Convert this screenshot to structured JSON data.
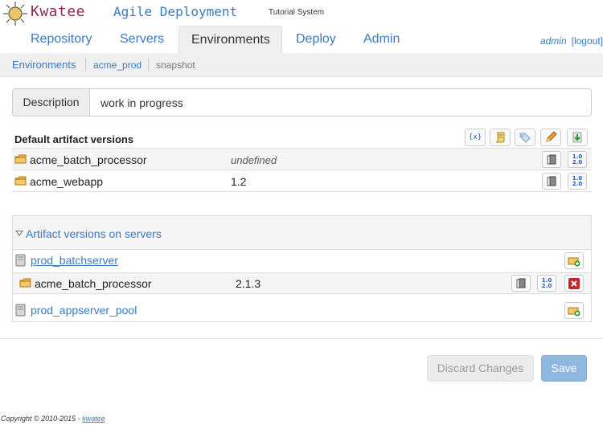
{
  "brand": {
    "name": "Kwatee",
    "subtitle": "Agile Deployment",
    "system": "Tutorial System"
  },
  "nav": {
    "tabs": [
      {
        "label": "Repository"
      },
      {
        "label": "Servers"
      },
      {
        "label": "Environments",
        "active": true
      },
      {
        "label": "Deploy"
      },
      {
        "label": "Admin"
      }
    ],
    "user": "admin",
    "logout": "[logout]"
  },
  "breadcrumb": {
    "items": [
      "Environments",
      "acme_prod",
      "snapshot"
    ]
  },
  "description": {
    "label": "Description",
    "value": "work in progress"
  },
  "default_versions": {
    "title": "Default artifact versions",
    "rows": [
      {
        "artifact": "acme_batch_processor",
        "version": "undefined"
      },
      {
        "artifact": "acme_webapp",
        "version": "1.2"
      }
    ]
  },
  "servers": {
    "title": "Artifact versions on servers",
    "items": [
      {
        "name": "prod_batchserver",
        "artifacts": [
          {
            "artifact": "acme_batch_processor",
            "version": "2.1.3"
          }
        ]
      },
      {
        "name": "prod_appserver_pool"
      }
    ]
  },
  "version_icon": {
    "line1": "1.0",
    "line2": "2.0"
  },
  "actions": {
    "discard": "Discard Changes",
    "save": "Save"
  },
  "footer": {
    "copyright": "Copyright © 2010-2015 - ",
    "link": "kwatee"
  },
  "colors": {
    "link": "#3a7abf",
    "brand": "#8b2a55",
    "save": "#8fb8e0",
    "delete": "#c0262c"
  }
}
